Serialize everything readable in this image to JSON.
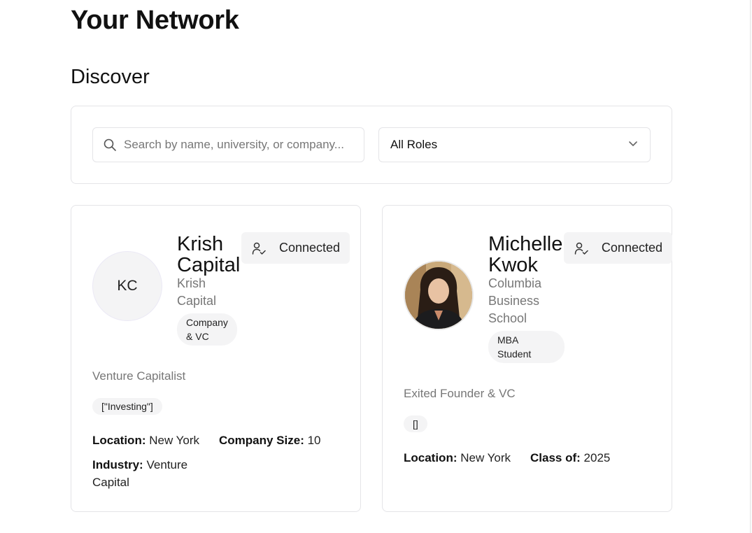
{
  "header": {
    "title": "Your Network",
    "section": "Discover"
  },
  "filters": {
    "search_placeholder": "Search by name, university, or company...",
    "search_icon": "search-icon",
    "role_selected": "All Roles",
    "chevron_icon": "chevron-down-icon"
  },
  "cards": [
    {
      "initials": "KC",
      "name_line1": "Krish",
      "name_line2": "Capital",
      "sub_line1": "Krish",
      "sub_line2": "Capital",
      "badge_line1": "Company",
      "badge_line2": "& VC",
      "connected_label": "Connected",
      "connected_icon": "user-check-icon",
      "role": "Venture Capitalist",
      "tag": "[\"Investing\"]",
      "location_label": "Location:",
      "location_value": "New York",
      "company_size_label": "Company Size:",
      "company_size_value": "10",
      "industry_label": "Industry:",
      "industry_value_line1": "Venture",
      "industry_value_line2": "Capital"
    },
    {
      "name_line1": "Michelle",
      "name_line2": "Kwok",
      "sub_line1": "Columbia",
      "sub_line2": "Business",
      "sub_line3": "School",
      "badge_line1": "MBA",
      "badge_line2": "Student",
      "connected_label": "Connected",
      "connected_icon": "user-check-icon",
      "role": "Exited Founder & VC",
      "tag": "[]",
      "location_label": "Location:",
      "location_value": "New York",
      "class_label": "Class of:",
      "class_value": "2025"
    }
  ]
}
